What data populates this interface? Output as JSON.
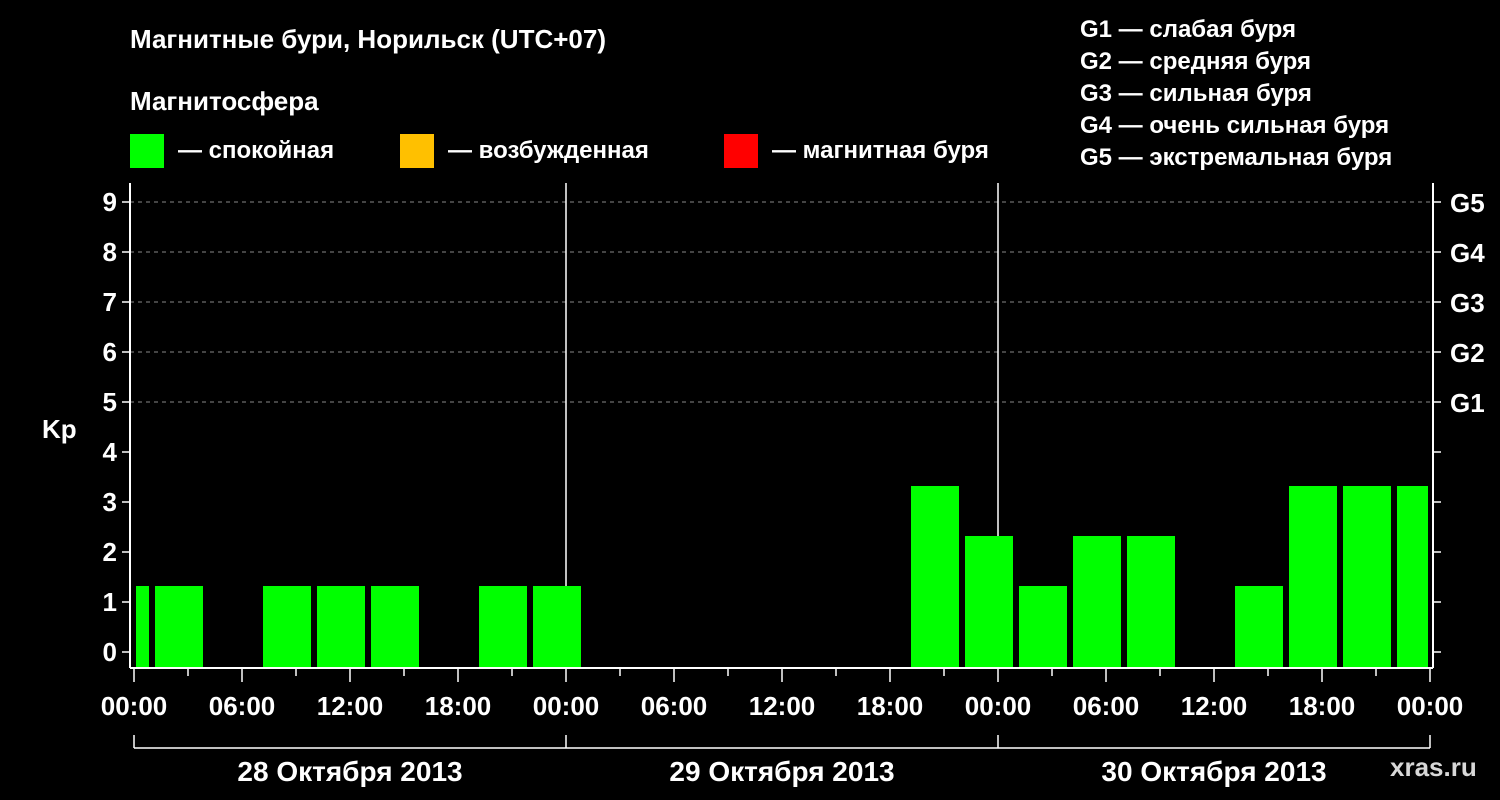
{
  "chart_data": {
    "type": "bar",
    "title": "Магнитные бури, Норильск (UTC+07)",
    "subtitle": "Магнитосфера",
    "ylabel": "Kp",
    "ylim": [
      0,
      9
    ],
    "yticks": [
      "0",
      "1",
      "2",
      "3",
      "4",
      "5",
      "6",
      "7",
      "8",
      "9"
    ],
    "g_ticks": [
      {
        "kp": 5,
        "label": "G1"
      },
      {
        "kp": 6,
        "label": "G2"
      },
      {
        "kp": 7,
        "label": "G3"
      },
      {
        "kp": 8,
        "label": "G4"
      },
      {
        "kp": 9,
        "label": "G5"
      }
    ],
    "x_tick_labels": [
      "00:00",
      "06:00",
      "12:00",
      "18:00",
      "00:00",
      "06:00",
      "12:00",
      "18:00",
      "00:00",
      "06:00",
      "12:00",
      "18:00",
      "00:00"
    ],
    "days": [
      "28 Октября 2013",
      "29 Октября 2013",
      "30 Октября 2013"
    ],
    "grid": true,
    "legend": {
      "calm": {
        "label": "— спокойная",
        "color": "#00ff00"
      },
      "excited": {
        "label": "— возбужденная",
        "color": "#ffc000"
      },
      "storm": {
        "label": "— магнитная буря",
        "color": "#ff0000"
      }
    },
    "series": [
      {
        "values": [
          1,
          1,
          0,
          1,
          1,
          1,
          0,
          1,
          1,
          0,
          0,
          0,
          0,
          0,
          0,
          3,
          2,
          1,
          2,
          2,
          0,
          1,
          3,
          3,
          3,
          3
        ],
        "bar_start_hours": [
          0,
          1,
          4,
          7,
          10,
          13,
          16,
          19,
          22,
          25,
          28,
          31,
          34,
          37,
          40,
          43,
          46,
          49,
          52,
          55,
          58,
          61,
          64,
          67,
          70,
          73
        ],
        "bar_end_hours": [
          1,
          4,
          7,
          10,
          13,
          16,
          19,
          22,
          25,
          28,
          31,
          34,
          37,
          40,
          43,
          46,
          49,
          52,
          55,
          58,
          61,
          64,
          67,
          70,
          73,
          72
        ]
      }
    ]
  },
  "g_legend": [
    "G1 — слабая буря",
    "G2 — средняя буря",
    "G3 — сильная буря",
    "G4 — очень сильная буря",
    "G5 — экстремальная буря"
  ],
  "watermark": "xras.ru"
}
